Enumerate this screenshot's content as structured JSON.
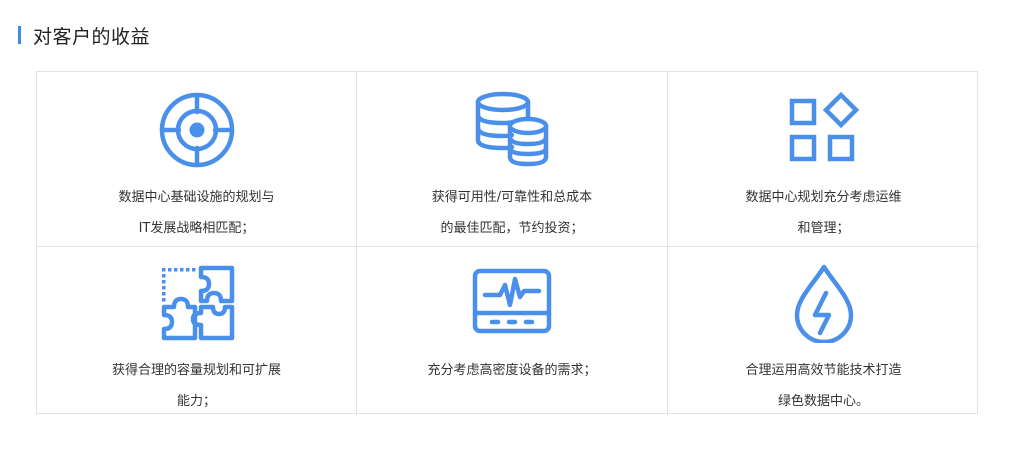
{
  "section": {
    "title": "对客户的收益"
  },
  "colors": {
    "accent": "#3a8ee6",
    "icon": "#4a90ea",
    "border": "#e3e3e3"
  },
  "benefits": [
    {
      "icon": "target-icon",
      "lines": [
        "数据中心基础设施的规划与",
        "IT发展战略相匹配；"
      ]
    },
    {
      "icon": "database-icon",
      "lines": [
        "获得可用性/可靠性和总成本",
        "的最佳匹配，节约投资；"
      ]
    },
    {
      "icon": "grid-apps-icon",
      "lines": [
        "数据中心规划充分考虑运维",
        "和管理；"
      ]
    },
    {
      "icon": "puzzle-icon",
      "lines": [
        "获得合理的容量规划和可扩展",
        "能力；"
      ]
    },
    {
      "icon": "monitor-pulse-icon",
      "lines": [
        "充分考虑高密度设备的需求；"
      ]
    },
    {
      "icon": "energy-drop-icon",
      "lines": [
        "合理运用高效节能技术打造",
        "绿色数据中心。"
      ]
    }
  ]
}
